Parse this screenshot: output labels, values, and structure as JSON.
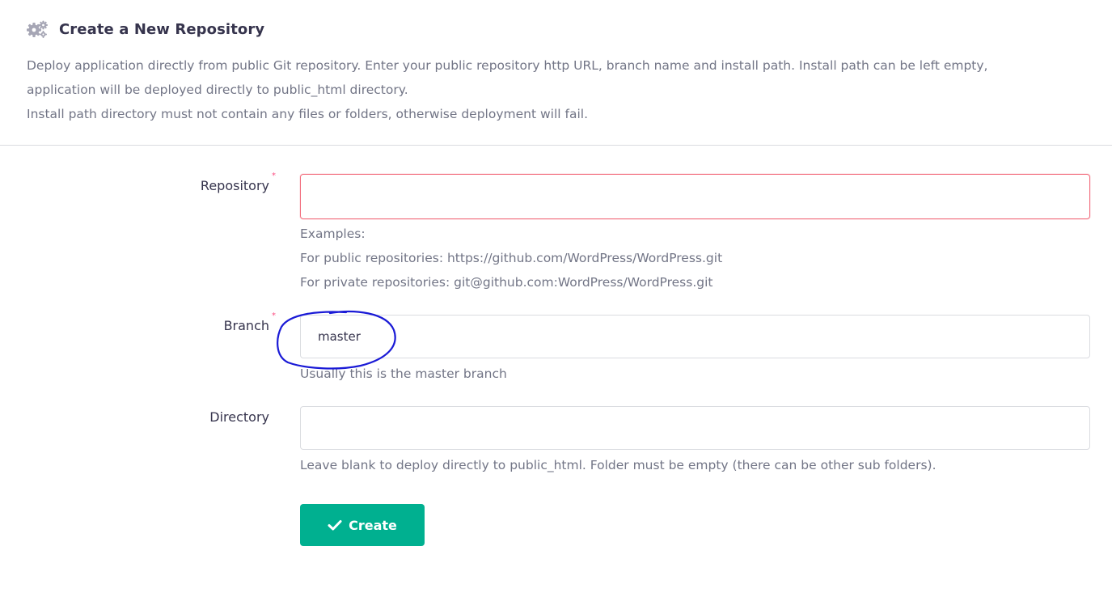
{
  "header": {
    "title": "Create a New Repository",
    "icon": "gears-icon",
    "description_lines": [
      "Deploy application directly from public Git repository. Enter your public repository http URL, branch name and install path. Install path can be left empty,",
      "application will be deployed directly to public_html directory.",
      "Install path directory must not contain any files or folders, otherwise deployment will fail."
    ]
  },
  "form": {
    "repository": {
      "label": "Repository",
      "required_mark": "*",
      "value": "",
      "help_lines": [
        "Examples:",
        "For public repositories: https://github.com/WordPress/WordPress.git",
        "For private repositories: git@github.com:WordPress/WordPress.git"
      ]
    },
    "branch": {
      "label": "Branch",
      "required_mark": "*",
      "value": "master",
      "help": "Usually this is the master branch"
    },
    "directory": {
      "label": "Directory",
      "value": "",
      "help": "Leave blank to deploy directly to public_html. Folder must be empty (there can be other sub folders)."
    }
  },
  "actions": {
    "create_label": "Create",
    "create_icon": "check-icon"
  },
  "colors": {
    "primary_button": "#00b090",
    "error_border": "#f26d7d",
    "required_mark": "#fc5185",
    "annotation_ink": "#1a1ad6"
  }
}
